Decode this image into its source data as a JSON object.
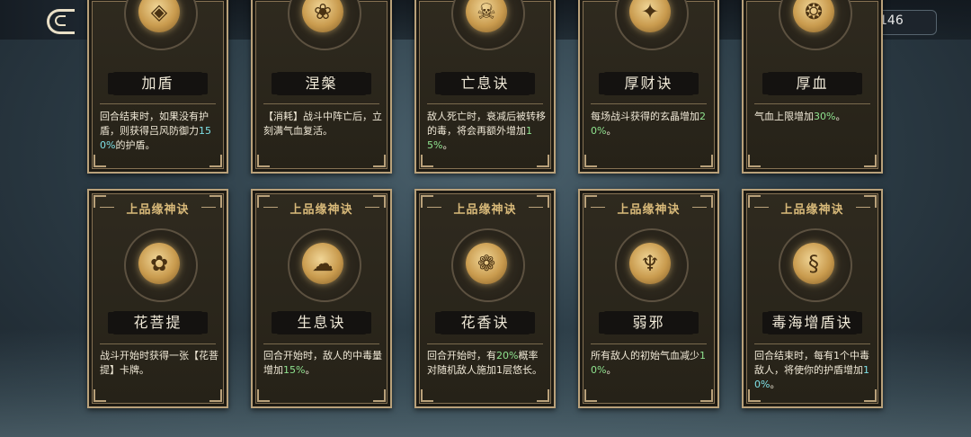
{
  "header": {
    "back_label": "返回",
    "currency_value": "146",
    "currency_icon": "crystal-icon"
  },
  "cards_top": [
    {
      "name": "加盾",
      "desc_a": "回合结束时，如果没有护盾，则获得吕风防御力",
      "desc_hl": "150%",
      "desc_b": "的护盾。",
      "hl_color": "cyan"
    },
    {
      "name": "涅槃",
      "desc_a": "【消耗】战斗中阵亡后，立刻满气血复活。",
      "desc_hl": "",
      "desc_b": ""
    },
    {
      "name": "亡息诀",
      "desc_a": "敌人死亡时，衰减后被转移的毒，将会再额外增加",
      "desc_hl": "15%",
      "desc_b": "。"
    },
    {
      "name": "厚财诀",
      "desc_a": "每场战斗获得的玄晶增加",
      "desc_hl": "20%",
      "desc_b": "。"
    },
    {
      "name": "厚血",
      "desc_a": "气血上限增加",
      "desc_hl": "30%",
      "desc_b": "。"
    }
  ],
  "cards_bottom": [
    {
      "grade": "上品缘神诀",
      "name": "花菩提",
      "desc_a": "战斗开始时获得一张【花菩提】卡牌。",
      "desc_hl": "",
      "desc_b": "",
      "icon": "lotus-icon"
    },
    {
      "grade": "上品缘神诀",
      "name": "生息诀",
      "desc_a": "回合开始时，敌人的中毒量增加",
      "desc_hl": "15%",
      "desc_b": "。",
      "icon": "cloud-icon"
    },
    {
      "grade": "上品缘神诀",
      "name": "花香诀",
      "desc_a": "回合开始时，有",
      "desc_hl": "20%",
      "desc_b": "概率对随机敌人施加1层悠长。",
      "icon": "flower-icon"
    },
    {
      "grade": "上品缘神诀",
      "name": "弱邪",
      "desc_a": "所有敌人的初始气血减少",
      "desc_hl": "10%",
      "desc_b": "。",
      "icon": "mask-icon"
    },
    {
      "grade": "上品缘神诀",
      "name": "毒海增盾诀",
      "desc_a": "回合结束时，每有1个中毒敌人，将使你的护盾增加",
      "desc_hl": "10%",
      "desc_b": "。",
      "icon": "serpent-icon"
    }
  ],
  "colors": {
    "highlight_cyan": "#7ee0e6",
    "highlight_green": "#8fe38f",
    "card_border": "#b9a17a"
  }
}
